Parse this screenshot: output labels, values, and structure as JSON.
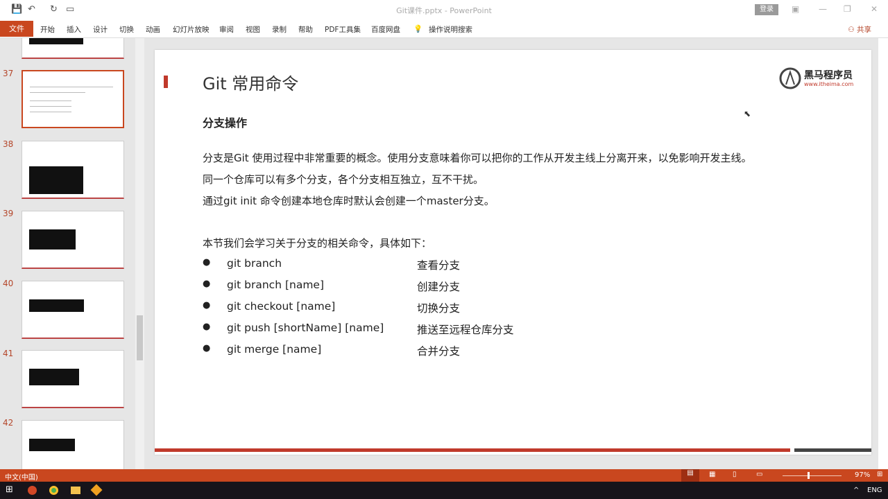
{
  "window": {
    "title": "Git课件.pptx - PowerPoint",
    "signin": "登录",
    "minimize": "—",
    "restore": "❐",
    "close": "✕"
  },
  "ribbon": {
    "file": "文件",
    "tabs": [
      "开始",
      "插入",
      "设计",
      "切换",
      "动画",
      "幻灯片放映",
      "审阅",
      "视图",
      "录制",
      "帮助",
      "PDF工具集",
      "百度网盘"
    ],
    "search": "操作说明搜索",
    "share": "共享"
  },
  "thumbnails": {
    "numbers": [
      "37",
      "38",
      "39",
      "40",
      "41",
      "42"
    ],
    "selected": "37"
  },
  "slide": {
    "title": "Git 常用命令",
    "logo": {
      "name": "黑马程序员",
      "url": "www.itheima.com"
    },
    "heading": "分支操作",
    "paragraphs": [
      "分支是Git 使用过程中非常重要的概念。使用分支意味着你可以把你的工作从开发主线上分离开来，以免影响开发主线。",
      "同一个仓库可以有多个分支，各个分支相互独立，互不干扰。",
      "通过git init 命令创建本地仓库时默认会创建一个master分支。"
    ],
    "intro": "本节我们会学习关于分支的相关命令，具体如下：",
    "commands": [
      {
        "cmd": "git branch",
        "desc": "查看分支"
      },
      {
        "cmd": "git branch [name]",
        "desc": "创建分支"
      },
      {
        "cmd": "git checkout [name]",
        "desc": "切换分支"
      },
      {
        "cmd": "git push [shortName] [name]",
        "desc": "推送至远程仓库分支"
      },
      {
        "cmd": "git merge [name]",
        "desc": "合并分支"
      }
    ]
  },
  "status": {
    "language": "中文(中国)",
    "zoom": "97%",
    "zoom_percent": 97
  },
  "taskbar": {
    "lang": "ENG"
  },
  "colors": {
    "accent": "#c9471f",
    "slide_red": "#c0392b"
  }
}
